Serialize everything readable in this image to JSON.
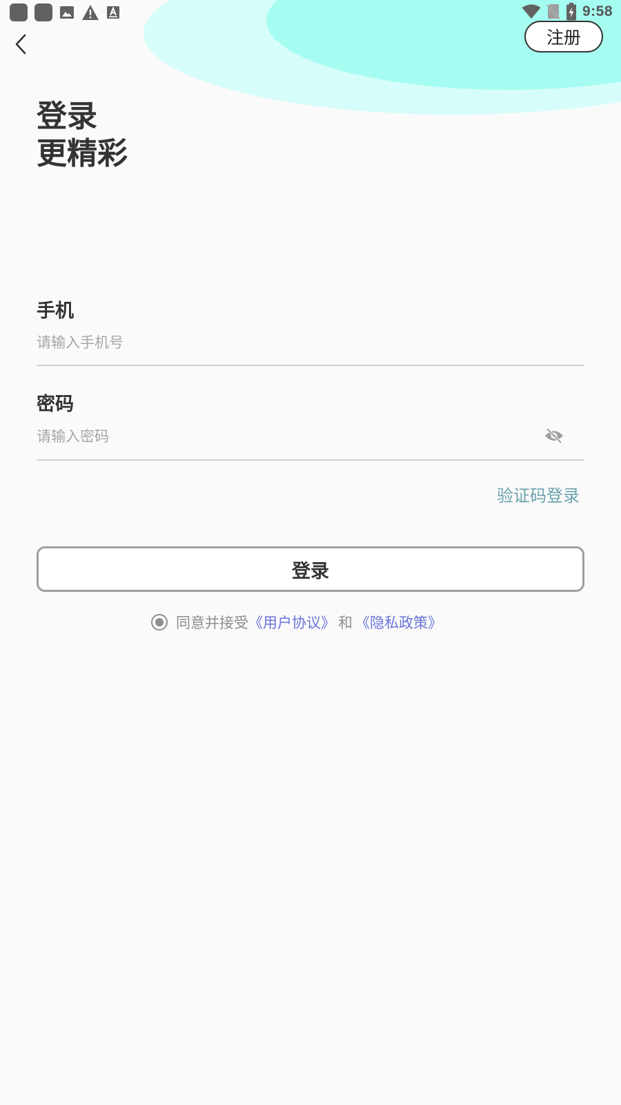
{
  "status_bar": {
    "time": "9:58",
    "left_icons": [
      "app-icon",
      "app-icon",
      "image-icon",
      "warning-icon",
      "keyboard-icon"
    ],
    "right_icons": [
      "wifi-icon",
      "no-sim-icon",
      "battery-charging-icon"
    ]
  },
  "top_bar": {
    "register_label": "注册"
  },
  "headline": {
    "line1": "登录",
    "line2": "更精彩"
  },
  "form": {
    "phone_label": "手机",
    "phone_placeholder": "请输入手机号",
    "password_label": "密码",
    "password_placeholder": "请输入密码",
    "sms_login_label": "验证码登录",
    "login_label": "登录"
  },
  "agreement": {
    "prefix": "同意并接受",
    "user_agreement": "《用户协议》",
    "and": "和",
    "privacy_policy": "《隐私政策》"
  },
  "colors": {
    "background": "#fafafa",
    "blob_light": "#d6fdfa",
    "blob_accent": "#a5fdf1",
    "link_teal": "#6aa3ad",
    "link_blue": "#6a74d8"
  }
}
